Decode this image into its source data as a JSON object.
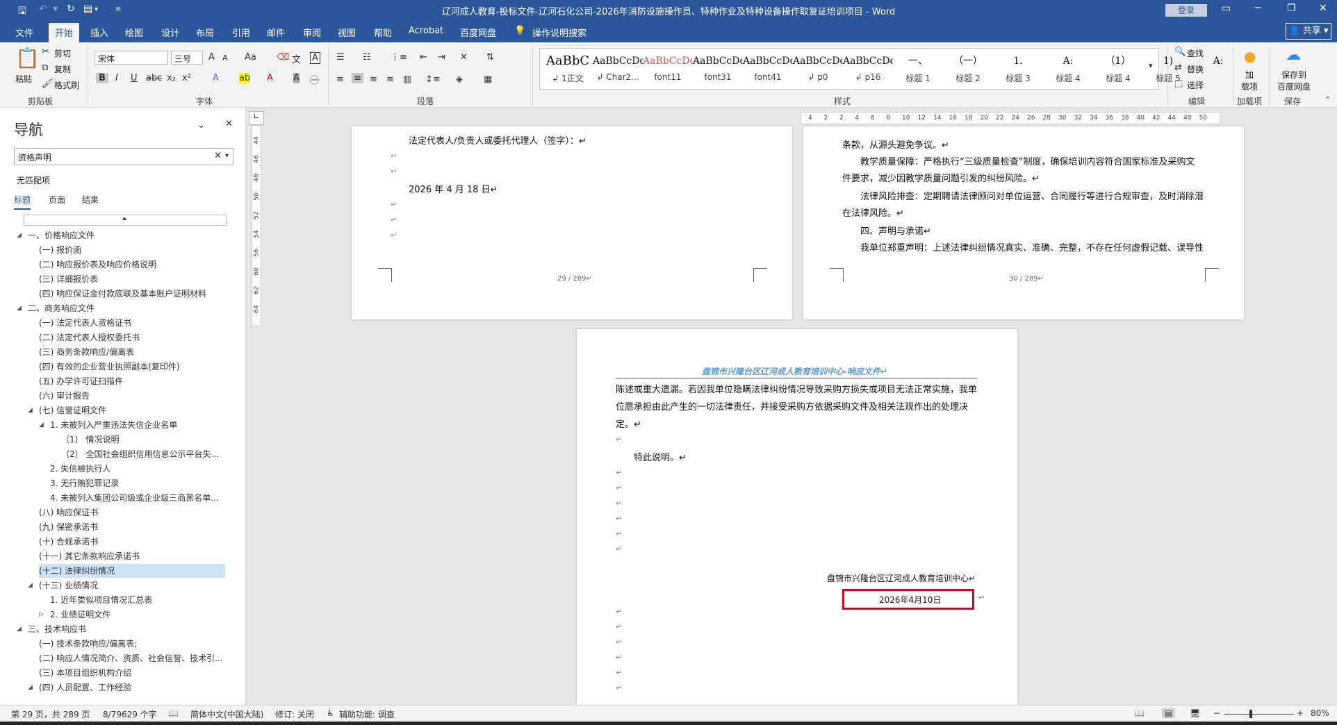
{
  "titlebar": {
    "title": "辽河成人教育-投标文件-辽河石化公司-2026年消防设施操作员、特种作业及特种设备操作取复证培训项目 - Word",
    "login": "登录",
    "quick_icons": [
      "save-icon",
      "undo-icon",
      "redo-icon",
      "refresh-icon",
      "new-doc-icon",
      "customize-icon"
    ]
  },
  "tabs": [
    "文件",
    "开始",
    "插入",
    "绘图",
    "设计",
    "布局",
    "引用",
    "邮件",
    "审阅",
    "视图",
    "帮助",
    "Acrobat",
    "百度网盘"
  ],
  "tell_me": "操作说明搜索",
  "share": "共享",
  "ribbon": {
    "clipboard": {
      "paste": "粘贴",
      "cut": "剪切",
      "copy": "复制",
      "format_painter": "格式刷",
      "label": "剪贴板"
    },
    "font": {
      "name": "宋体",
      "size": "三号",
      "label": "字体"
    },
    "paragraph": {
      "label": "段落"
    },
    "styles": {
      "label": "样式",
      "items": [
        {
          "sample": "AaBbC",
          "name": "↲ 1正文",
          "color": "#111111"
        },
        {
          "sample": "AaBbCcDdI",
          "name": "↲ Char2...",
          "color": "#111111"
        },
        {
          "sample": "AaBbCcDdI",
          "name": "font11",
          "color": "#e05050"
        },
        {
          "sample": "AaBbCcDc",
          "name": "font31",
          "color": "#111111"
        },
        {
          "sample": "AaBbCcDdI",
          "name": "font41",
          "color": "#111111"
        },
        {
          "sample": "AaBbCcDc",
          "name": "↲ p0",
          "color": "#111111"
        },
        {
          "sample": "AaBbCcDc",
          "name": "↲ p16",
          "color": "#111111"
        },
        {
          "sample": "一、",
          "name": "标题 1",
          "color": "#111111"
        },
        {
          "sample": "（一）",
          "name": "标题 2",
          "color": "#111111"
        },
        {
          "sample": "1.",
          "name": "标题 3",
          "color": "#111111"
        },
        {
          "sample": "A:",
          "name": "标题 4",
          "color": "#111111"
        },
        {
          "sample": "（1）",
          "name": "标题 4",
          "color": "#111111"
        },
        {
          "sample": "1)",
          "name": "标题 5",
          "color": "#111111"
        },
        {
          "sample": "A:",
          "name": "",
          "color": "#111111"
        }
      ]
    },
    "editing": {
      "find": "查找",
      "replace": "替换",
      "select": "选择",
      "label": "编辑"
    },
    "addin": {
      "btn": "加\n载项",
      "label": "加载项"
    },
    "save": {
      "btn": "保存到\n百度网盘",
      "label": "保存"
    }
  },
  "nav": {
    "title": "导航",
    "search_value": "资格声明",
    "no_match": "无匹配项",
    "tabs": [
      "标题",
      "页面",
      "结果"
    ],
    "items": [
      {
        "text": "一、价格响应文件",
        "indent": 0,
        "caret": "▲"
      },
      {
        "text": "(一) 报价函",
        "indent": 1
      },
      {
        "text": "(二) 响应报价表及响应价格说明",
        "indent": 1
      },
      {
        "text": "(三) 详细报价表",
        "indent": 1
      },
      {
        "text": "(四) 响应保证金付款底联及基本账户证明材料",
        "indent": 1
      },
      {
        "text": "二、商务响应文件",
        "indent": 0,
        "caret": "▲"
      },
      {
        "text": "(一) 法定代表人资格证书",
        "indent": 1
      },
      {
        "text": "(二) 法定代表人授权委托书",
        "indent": 1
      },
      {
        "text": "(三) 商务条款响应/偏离表",
        "indent": 1
      },
      {
        "text": "(四) 有效的企业营业执照副本(复印件)",
        "indent": 1
      },
      {
        "text": "(五) 办学许可证扫描件",
        "indent": 1
      },
      {
        "text": "(六) 审计报告",
        "indent": 1
      },
      {
        "text": "(七) 信誉证明文件",
        "indent": 1,
        "caret": "▲"
      },
      {
        "text": "1. 未被列入严重违法失信企业名单",
        "indent": 2,
        "caret": "▲"
      },
      {
        "text": "（1） 情况说明",
        "indent": 3
      },
      {
        "text": "（2） 全国社会组织信用信息公示平台失...",
        "indent": 3
      },
      {
        "text": "2. 失信被执行人",
        "indent": 2
      },
      {
        "text": "3. 无行贿犯罪记录",
        "indent": 2
      },
      {
        "text": "4. 未被列入集团公司级或企业级三商黑名单...",
        "indent": 2
      },
      {
        "text": "(八) 响应保证书",
        "indent": 1
      },
      {
        "text": "(九) 保密承诺书",
        "indent": 1
      },
      {
        "text": "(十) 合规承诺书",
        "indent": 1
      },
      {
        "text": "(十一) 其它条款响应承诺书",
        "indent": 1
      },
      {
        "text": "(十二) 法律纠纷情况",
        "indent": 1,
        "selected": true
      },
      {
        "text": "(十三) 业绩情况",
        "indent": 1,
        "caret": "▲"
      },
      {
        "text": "1. 近年类似项目情况汇总表",
        "indent": 2
      },
      {
        "text": "2. 业绩证明文件",
        "indent": 2,
        "caret": "▷"
      },
      {
        "text": "三、技术响应书",
        "indent": 0,
        "caret": "▲"
      },
      {
        "text": "(一) 技术条款响应/偏离表;",
        "indent": 1
      },
      {
        "text": "(二) 响应人情况简介、资质、社会信誉、技术引...",
        "indent": 1
      },
      {
        "text": "(三) 本项目组织机构介绍",
        "indent": 1
      },
      {
        "text": "(四) 人员配置、工作经验",
        "indent": 1,
        "caret": "▲"
      }
    ]
  },
  "ruler": {
    "vertical": [
      "44",
      "46",
      "48",
      "50",
      "52",
      "54",
      "56",
      "60",
      "62",
      "64"
    ],
    "horizontal": [
      "4",
      "2",
      "2",
      "4",
      "6",
      "8",
      "10",
      "12",
      "14",
      "16",
      "18",
      "20",
      "22",
      "24",
      "26",
      "28",
      "30",
      "32",
      "34",
      "36",
      "38",
      "40",
      "42",
      "44",
      "48",
      "50"
    ]
  },
  "pages": {
    "p29": {
      "line1": "法定代表人/负责人或委托代理人（签字）：↵",
      "date": "2026 年 4 月 18 日↵",
      "footer": "29 / 289↵"
    },
    "p30": {
      "line0": "条款，从源头避免争议。↵",
      "line1": "教学质量保障：严格执行“三级质量检查”制度，确保培训内容符合国家标准及采购文",
      "line2": "件要求，减少因教学质量问题引发的纠纷风险。↵",
      "line3": "法律风险排查：定期聘请法律顾问对单位运营、合同履行等进行合规审查，及时消除潜",
      "line4": "在法律风险。↵",
      "line5": "四、声明与承诺↵",
      "line6": "我单位郑重声明：上述法律纠纷情况真实、准确、完整，不存在任何虚假记载、误导性",
      "footer": "30 / 289↵"
    },
    "p31": {
      "header": "盘锦市兴隆台区辽河成人教育培训中心-响应文件↵",
      "line1": "陈述或重大遗漏。若因我单位隐瞒法律纠纷情况导致采购方损失或项目无法正常实施，我单",
      "line2": "位愿承担由此产生的一切法律责任，并接受采购方依据采购文件及相关法规作出的处理决",
      "line3": "定。↵",
      "statement": "特此说明。↵",
      "org": "盘锦市兴隆台区辽河成人教育培训中心↵",
      "date": "2026年4月10日"
    }
  },
  "status": {
    "page": "第 29 页，共 289 页",
    "words": "8/79629 个字",
    "lang": "简体中文(中国大陆)",
    "track": "修订: 关闭",
    "access": "辅助功能: 调查",
    "zoom": "80%"
  },
  "colors": {
    "brand": "#2b579a",
    "highlight_box": "#d9001b",
    "header_text": "#5b9bd5"
  }
}
